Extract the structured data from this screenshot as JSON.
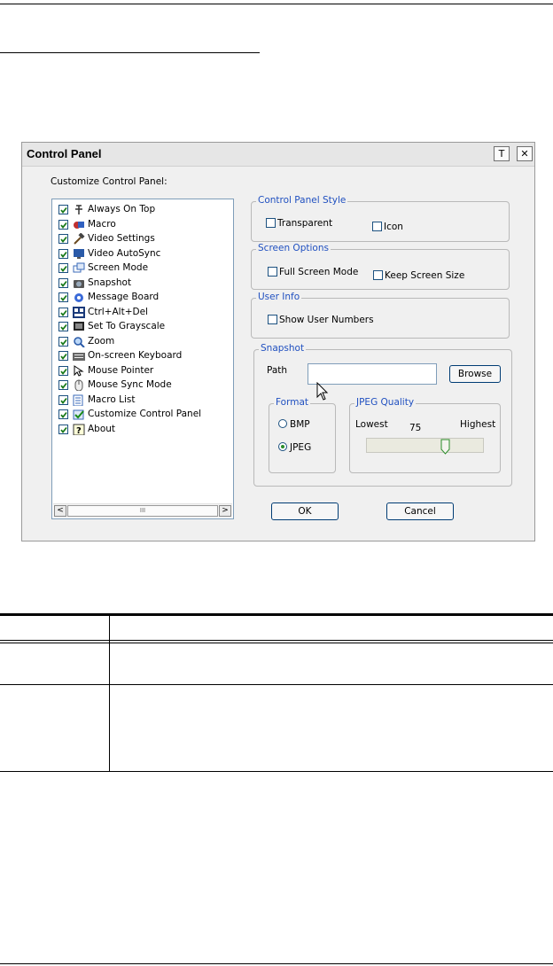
{
  "dialog": {
    "title": "Control Panel",
    "pin_button": "T",
    "close_button": "✕",
    "customize_label": "Customize Control Panel:",
    "items": [
      {
        "label": "Always On Top",
        "icon": "pin-icon",
        "checked": true
      },
      {
        "label": "Macro",
        "icon": "macro-icon",
        "checked": true
      },
      {
        "label": "Video Settings",
        "icon": "hammer-icon",
        "checked": true
      },
      {
        "label": "Video AutoSync",
        "icon": "monitor-sync-icon",
        "checked": true
      },
      {
        "label": "Screen Mode",
        "icon": "screen-mode-icon",
        "checked": true
      },
      {
        "label": "Snapshot",
        "icon": "camera-icon",
        "checked": true
      },
      {
        "label": "Message Board",
        "icon": "message-board-icon",
        "checked": true
      },
      {
        "label": "Ctrl+Alt+Del",
        "icon": "ctrl-alt-del-icon",
        "checked": true
      },
      {
        "label": "Set To Grayscale",
        "icon": "grayscale-icon",
        "checked": true
      },
      {
        "label": "Zoom",
        "icon": "magnifier-icon",
        "checked": true
      },
      {
        "label": "On-screen Keyboard",
        "icon": "keyboard-icon",
        "checked": true
      },
      {
        "label": "Mouse Pointer",
        "icon": "mouse-pointer-icon",
        "checked": true
      },
      {
        "label": "Mouse Sync Mode",
        "icon": "mouse-sync-icon",
        "checked": true
      },
      {
        "label": "Macro List",
        "icon": "macro-list-icon",
        "checked": true
      },
      {
        "label": "Customize Control Panel",
        "icon": "customize-icon",
        "checked": true
      },
      {
        "label": "About",
        "icon": "about-icon",
        "checked": true
      }
    ],
    "scroll_left": "<",
    "scroll_right": ">",
    "scroll_thumb": "III",
    "style_group": {
      "title": "Control Panel Style",
      "transparent": "Transparent",
      "icon": "Icon"
    },
    "screen_group": {
      "title": "Screen Options",
      "full_screen": "Full Screen Mode",
      "keep_size": "Keep Screen Size"
    },
    "user_group": {
      "title": "User Info",
      "show_numbers": "Show User Numbers"
    },
    "snapshot_group": {
      "title": "Snapshot",
      "path_label": "Path",
      "path_value": "",
      "browse": "Browse",
      "format_title": "Format",
      "format_options": [
        "BMP",
        "JPEG"
      ],
      "format_selected": "JPEG",
      "quality_title": "JPEG Quality",
      "quality_low": "Lowest",
      "quality_high": "Highest",
      "quality_value": "75"
    },
    "ok": "OK",
    "cancel": "Cancel"
  },
  "colors": {
    "group_title": "#2050c0",
    "checkmark": "#1a7a1a",
    "dialog_bg": "#f0f0f0"
  }
}
